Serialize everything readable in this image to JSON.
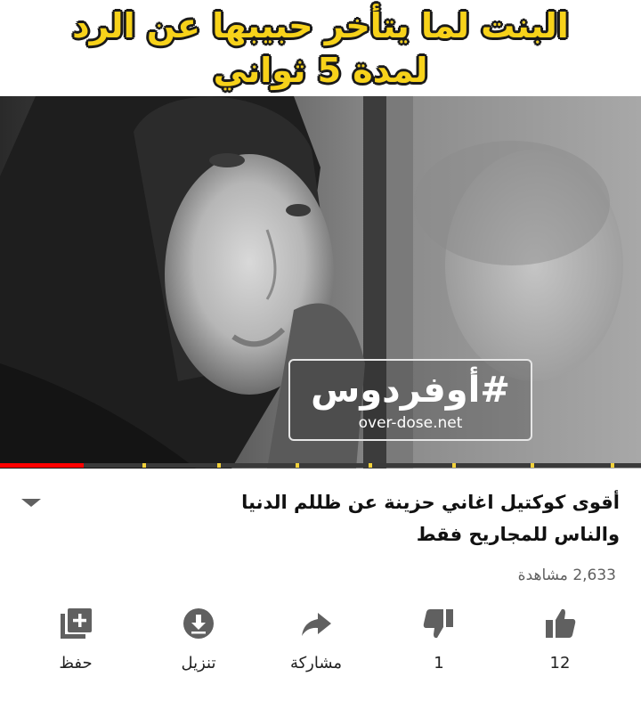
{
  "caption": {
    "line1": "البنت لما يتأخر حبيبها عن الرد",
    "line2": "لمدة 5 ثواني"
  },
  "watermark": {
    "title": "#أوفردوس",
    "url": "over-dose.net"
  },
  "player": {
    "progress_fraction": 0.13
  },
  "video": {
    "title_line1": "أقوى كوكتيل اغاني حزينة عن ظللم الدنيا",
    "title_line2": "والناس للمجاريح فقط",
    "views": "2,633 مشاهدة"
  },
  "actions": {
    "like_count": "12",
    "dislike_count": "1",
    "share_label": "مشاركة",
    "download_label": "تنزيل",
    "save_label": "حفظ"
  },
  "colors": {
    "caption_text": "#f7d21a",
    "progress": "#ff0000",
    "ad_marker": "#f3d23a",
    "icon": "#606060"
  }
}
